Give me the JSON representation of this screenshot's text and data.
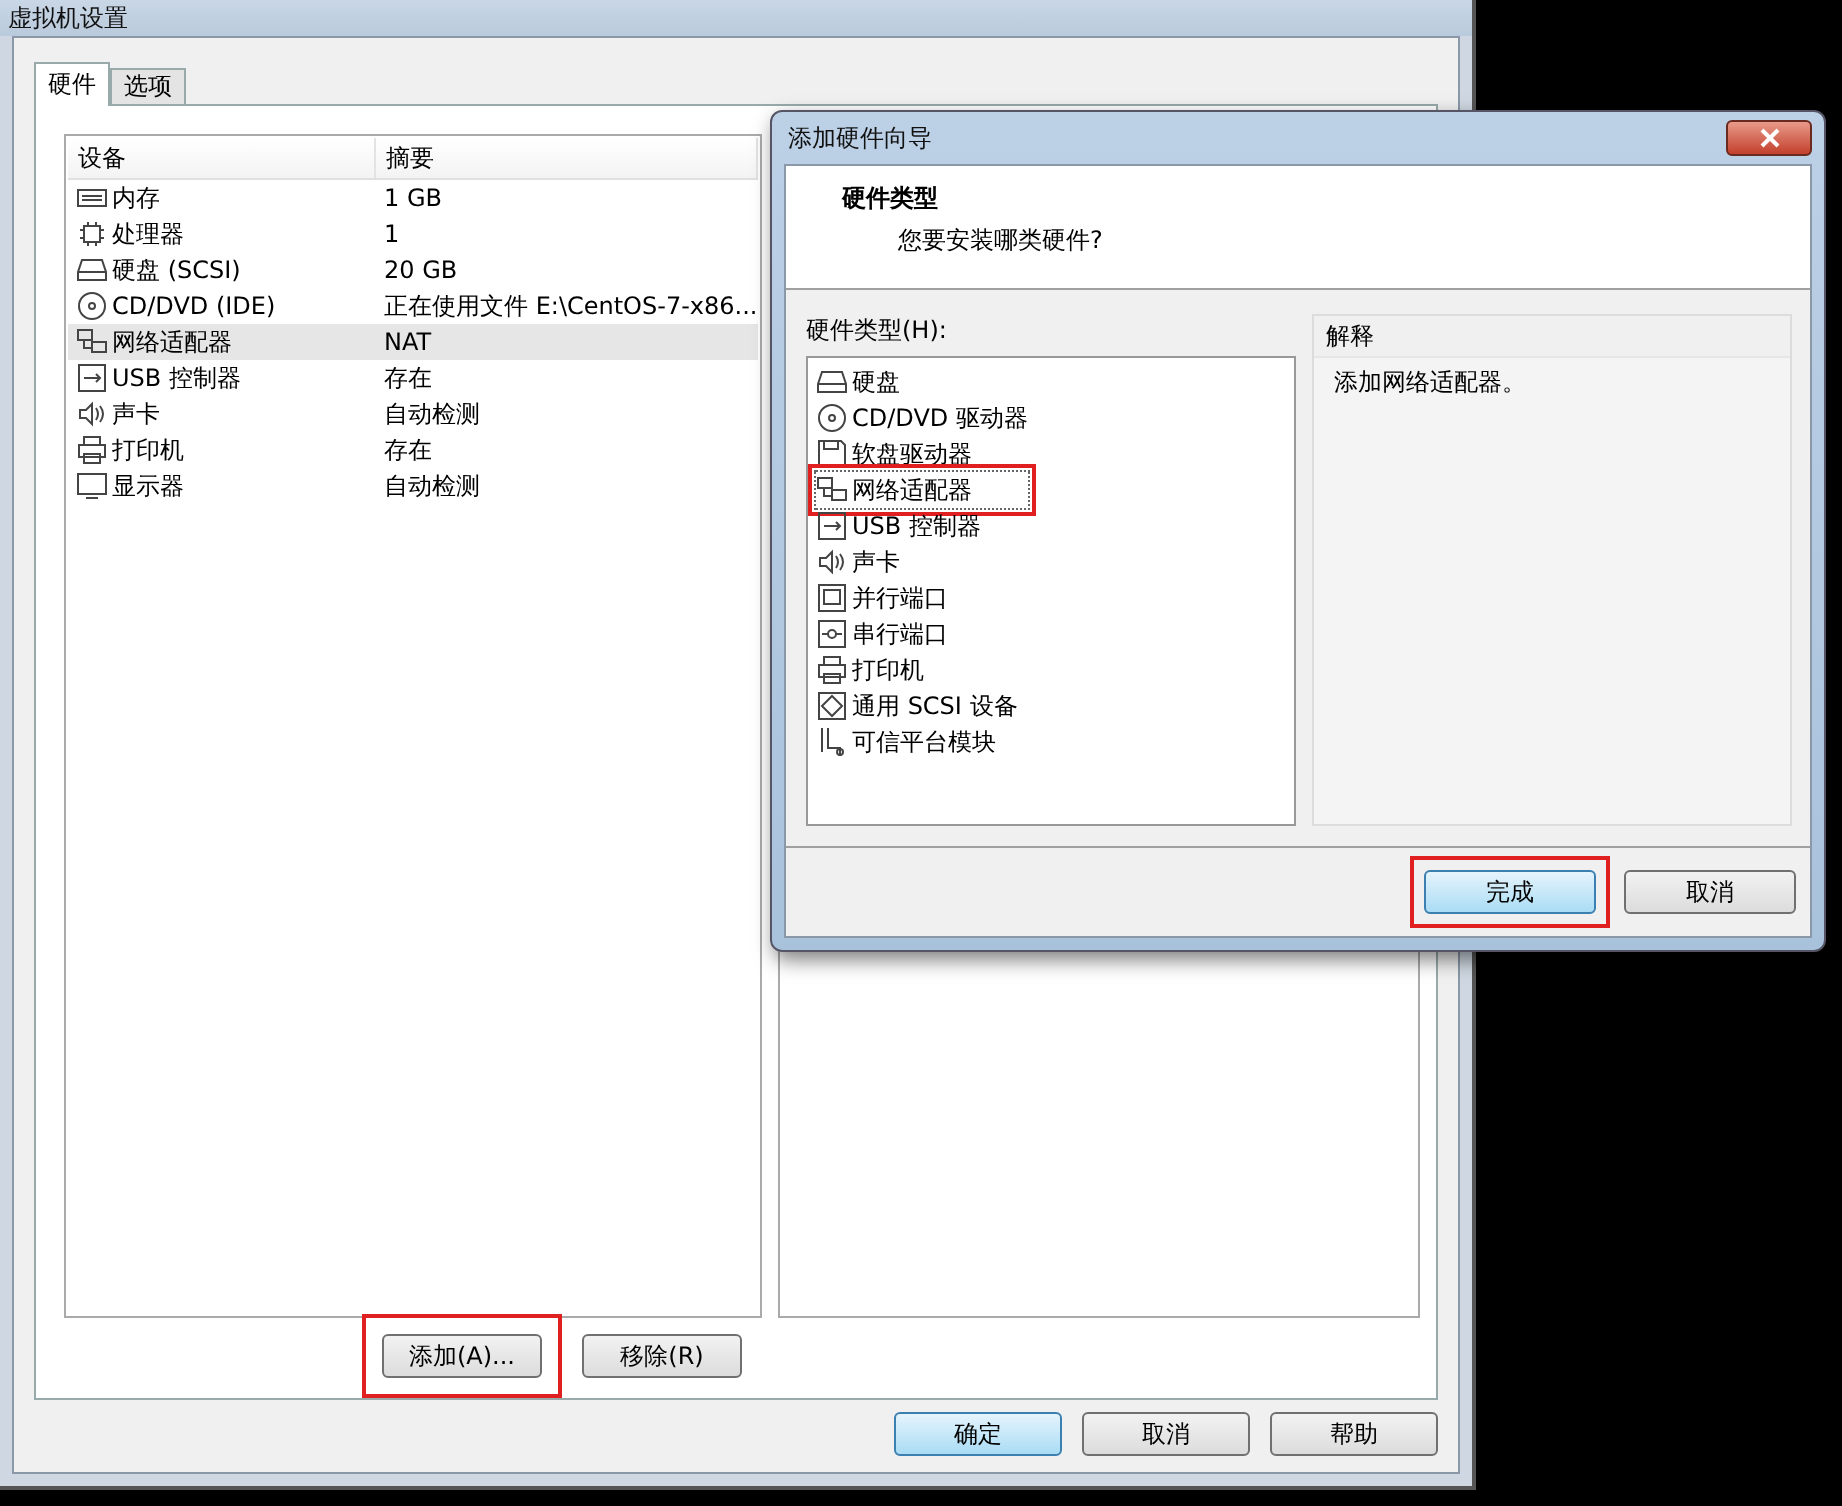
{
  "window": {
    "title": "虚拟机设置"
  },
  "tabs": [
    {
      "label": "硬件",
      "selected": true
    },
    {
      "label": "选项",
      "selected": false
    }
  ],
  "device_table": {
    "columns": [
      "设备",
      "摘要"
    ],
    "rows": [
      {
        "kind": "memory",
        "device": "内存",
        "summary": "1 GB",
        "selected": false
      },
      {
        "kind": "cpu",
        "device": "处理器",
        "summary": "1",
        "selected": false
      },
      {
        "kind": "disk",
        "device": "硬盘 (SCSI)",
        "summary": "20 GB",
        "selected": false
      },
      {
        "kind": "cd",
        "device": "CD/DVD (IDE)",
        "summary": "正在使用文件 E:\\CentOS-7-x86...",
        "selected": false
      },
      {
        "kind": "network",
        "device": "网络适配器",
        "summary": "NAT",
        "selected": true
      },
      {
        "kind": "usb",
        "device": "USB 控制器",
        "summary": "存在",
        "selected": false
      },
      {
        "kind": "sound",
        "device": "声卡",
        "summary": "自动检测",
        "selected": false
      },
      {
        "kind": "printer",
        "device": "打印机",
        "summary": "存在",
        "selected": false
      },
      {
        "kind": "display",
        "device": "显示器",
        "summary": "自动检测",
        "selected": false
      }
    ]
  },
  "device_buttons": [
    {
      "label": "添加(A)...",
      "annotated": true
    },
    {
      "label": "移除(R)",
      "annotated": false
    }
  ],
  "footer_buttons": [
    {
      "label": "确定",
      "default": true
    },
    {
      "label": "取消",
      "default": false
    },
    {
      "label": "帮助",
      "default": false
    }
  ],
  "wizard": {
    "title": "添加硬件向导",
    "heading": "硬件类型",
    "subheading": "您要安装哪类硬件?",
    "list_label": "硬件类型(H):",
    "items": [
      {
        "kind": "disk",
        "label": "硬盘",
        "selected": false,
        "annotated": false
      },
      {
        "kind": "cd",
        "label": "CD/DVD 驱动器",
        "selected": false,
        "annotated": false
      },
      {
        "kind": "floppy",
        "label": "软盘驱动器",
        "selected": false,
        "annotated": false
      },
      {
        "kind": "network",
        "label": "网络适配器",
        "selected": true,
        "annotated": true
      },
      {
        "kind": "usb",
        "label": "USB 控制器",
        "selected": false,
        "annotated": false
      },
      {
        "kind": "sound",
        "label": "声卡",
        "selected": false,
        "annotated": false
      },
      {
        "kind": "parallel",
        "label": "并行端口",
        "selected": false,
        "annotated": false
      },
      {
        "kind": "serial",
        "label": "串行端口",
        "selected": false,
        "annotated": false
      },
      {
        "kind": "printer",
        "label": "打印机",
        "selected": false,
        "annotated": false
      },
      {
        "kind": "scsi",
        "label": "通用 SCSI 设备",
        "selected": false,
        "annotated": false
      },
      {
        "kind": "tpm",
        "label": "可信平台模块",
        "selected": false,
        "annotated": false
      }
    ],
    "explanation_label": "解释",
    "explanation": "添加网络适配器。",
    "buttons": [
      {
        "label": "完成",
        "default": true,
        "annotated": true
      },
      {
        "label": "取消",
        "default": false,
        "annotated": false
      }
    ]
  }
}
